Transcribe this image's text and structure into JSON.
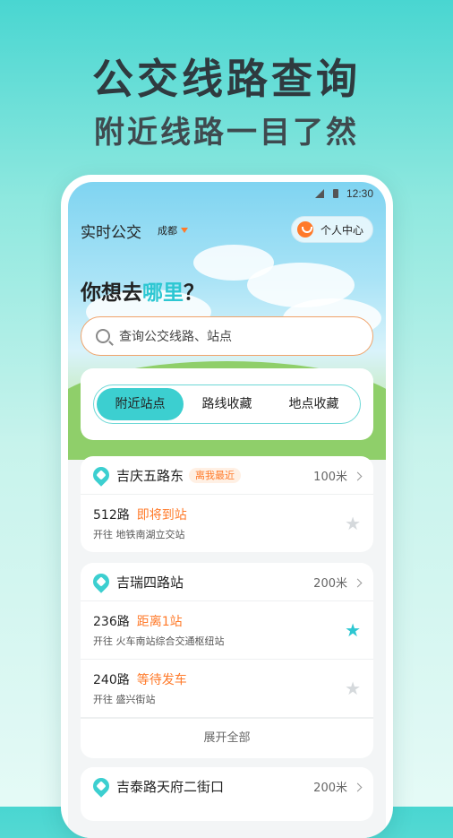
{
  "promo": {
    "title": "公交线路查询",
    "subtitle": "附近线路一目了然"
  },
  "status_bar": {
    "time": "12:30"
  },
  "header": {
    "title": "实时公交",
    "city": "成都",
    "user_center": "个人中心"
  },
  "question": {
    "prefix": "你想去",
    "highlight": "哪里",
    "suffix": "？"
  },
  "search": {
    "placeholder": "查询公交线路、站点"
  },
  "tabs": [
    {
      "label": "附近站点",
      "active": true
    },
    {
      "label": "路线收藏",
      "active": false
    },
    {
      "label": "地点收藏",
      "active": false
    }
  ],
  "stops": [
    {
      "name": "吉庆五路东",
      "badge": "离我最近",
      "distance": "100米",
      "routes": [
        {
          "number": "512路",
          "status": "即将到站",
          "direction": "开往 地铁南湖立交站",
          "favorited": false
        }
      ]
    },
    {
      "name": "吉瑞四路站",
      "badge": "",
      "distance": "200米",
      "routes": [
        {
          "number": "236路",
          "status": "距离1站",
          "direction": "开往 火车南站综合交通枢纽站",
          "favorited": true
        },
        {
          "number": "240路",
          "status": "等待发车",
          "direction": "开往 盛兴街站",
          "favorited": false
        }
      ],
      "expand_label": "展开全部"
    },
    {
      "name": "吉泰路天府二街口",
      "badge": "",
      "distance": "200米",
      "routes": []
    }
  ],
  "colors": {
    "accent": "#3ccfd0",
    "warning": "#ff7a2a"
  }
}
